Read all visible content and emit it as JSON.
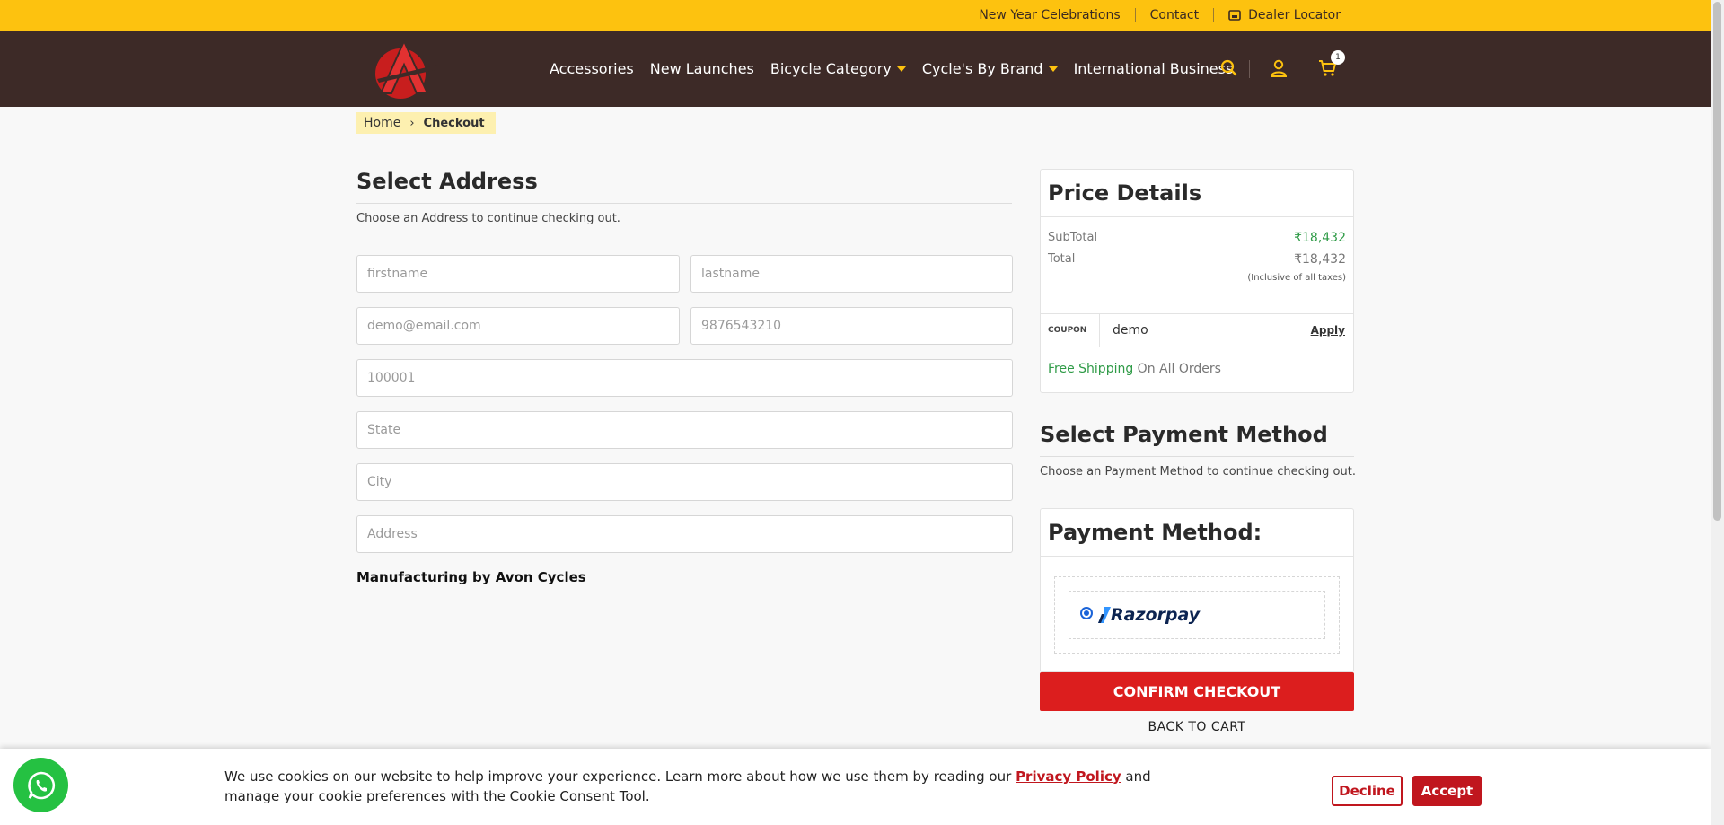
{
  "topbar": {
    "links": [
      "New Year Celebrations",
      "Contact",
      "Dealer Locator"
    ]
  },
  "nav": {
    "items": [
      {
        "label": "Accessories"
      },
      {
        "label": "New Launches"
      },
      {
        "label": "Bicycle Category"
      },
      {
        "label": "Cycle's By Brand"
      },
      {
        "label": "International Business"
      }
    ],
    "cart_count": "1",
    "icons": [
      "search-icon",
      "user-icon",
      "cart-icon"
    ]
  },
  "breadcrumb": {
    "home": "Home",
    "current": "Checkout"
  },
  "address": {
    "title": "Select Address",
    "subtitle": "Choose an Address to continue checking out.",
    "placeholders": {
      "firstname": "firstname",
      "lastname": "lastname",
      "email": "demo@email.com",
      "phone": "9876543210",
      "pincode": "100001",
      "state": "State",
      "city": "City",
      "address": "Address"
    },
    "manufacturing": "Manufacturing by Avon Cycles"
  },
  "price": {
    "title": "Price Details",
    "subtotal_label": "SubTotal",
    "subtotal_value": "₹18,432",
    "total_label": "Total",
    "total_value": "₹18,432",
    "tax_note": "(Inclusive of all taxes)",
    "coupon_label": "COUPON",
    "coupon_value": "demo",
    "apply_label": "Apply",
    "shipping_highlight": "Free Shipping",
    "shipping_rest": " On All Orders"
  },
  "payment": {
    "title": "Select Payment Method",
    "subtitle": "Choose an Payment Method to continue checking out.",
    "card_title": "Payment Method:",
    "option": "Razorpay",
    "confirm_label": "CONFIRM CHECKOUT",
    "back_label": "BACK TO CART"
  },
  "cookie": {
    "text_before": "We use cookies on our website to help improve your experience. Learn more about how we use them by reading our ",
    "link": "Privacy Policy",
    "text_after": " and manage your cookie preferences with the Cookie Consent Tool.",
    "decline": "Decline",
    "accept": "Accept"
  },
  "colors": {
    "topbar": "#fdc20f",
    "navbar": "#3d2a27",
    "accent_red": "#dc1e1e",
    "green": "#2f9b47"
  }
}
